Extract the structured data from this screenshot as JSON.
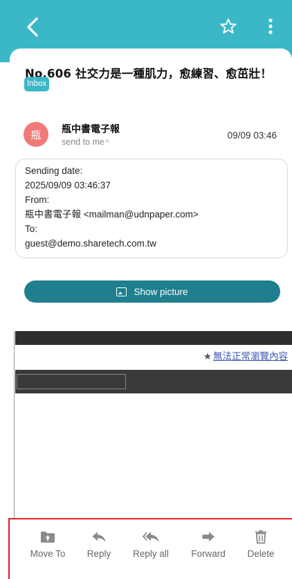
{
  "header": {
    "back_icon": "chevron-left-icon",
    "star_icon": "star-outline-icon",
    "more_icon": "more-vertical-icon",
    "color": "#3bb8c8"
  },
  "mail": {
    "subject": "No.606 社交力是一種肌力，愈練習、愈茁壯！",
    "folder_badge": "Inbox",
    "sender": {
      "avatar_text": "瓶",
      "name": "瓶中書電子報",
      "send_to": "send to me",
      "time": "09/09 03:46"
    },
    "meta": {
      "sending_date_label": "Sending date:",
      "sending_date_value": "2025/09/09 03:46:37",
      "from_label": "From:",
      "from_value": "瓶中書電子報 <mailman@udnpaper.com>",
      "to_label": "To:",
      "to_value": "guest@demo.sharetech.com.tw"
    },
    "show_picture_label": "Show picture"
  },
  "email_body": {
    "browse_link_star": "★",
    "browse_link_text": "無法正常瀏覽內容"
  },
  "actions": [
    {
      "label": "Move To",
      "icon": "folder-move-icon"
    },
    {
      "label": "Reply",
      "icon": "reply-icon"
    },
    {
      "label": "Reply all",
      "icon": "reply-all-icon"
    },
    {
      "label": "Forward",
      "icon": "forward-icon"
    },
    {
      "label": "Delete",
      "icon": "trash-icon"
    }
  ],
  "colors": {
    "accent": "#3bb8c8",
    "button_dark": "#1f7f8e",
    "avatar": "#f07a78",
    "highlight_border": "#e02020"
  }
}
